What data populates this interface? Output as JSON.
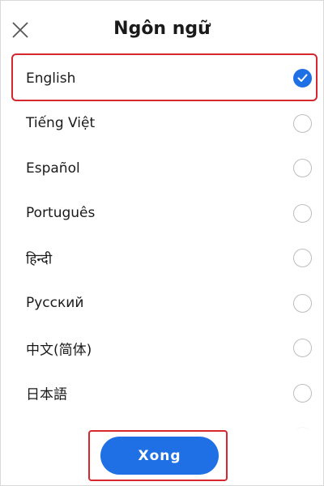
{
  "header": {
    "title": "Ngôn ngữ",
    "close_icon": "close-icon"
  },
  "languages": [
    {
      "label": "English",
      "selected": true
    },
    {
      "label": "Tiếng Việt",
      "selected": false
    },
    {
      "label": "Español",
      "selected": false
    },
    {
      "label": "Português",
      "selected": false
    },
    {
      "label": "हिन्दी",
      "selected": false
    },
    {
      "label": "Русский",
      "selected": false
    },
    {
      "label": "中文(简体)",
      "selected": false
    },
    {
      "label": "日本語",
      "selected": false
    }
  ],
  "footer": {
    "done_label": "Xong"
  },
  "colors": {
    "accent": "#1f6fe5",
    "highlight": "#d6262e"
  }
}
